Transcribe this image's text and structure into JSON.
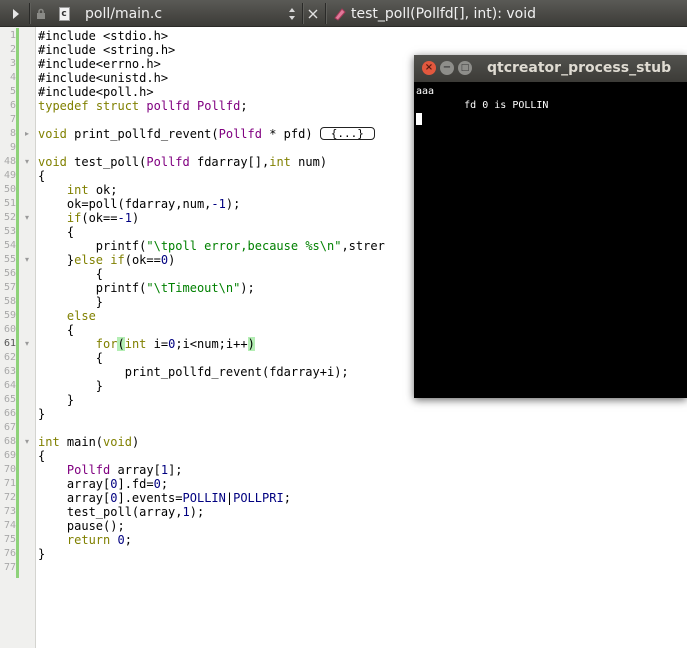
{
  "toolbar": {
    "file_name": "poll/main.c",
    "file_type_letter": "c",
    "function_signature": "test_poll(Pollfd[], int): void",
    "icons": [
      "forward-icon",
      "lock-icon",
      "file-c-icon",
      "updown-arrow-icon",
      "close-icon",
      "function-tag-icon"
    ]
  },
  "editor": {
    "current_line": "61",
    "line_numbers": [
      "1",
      "2",
      "3",
      "4",
      "5",
      "6",
      "7",
      "8",
      "9",
      "48",
      "49",
      "50",
      "51",
      "52",
      "53",
      "54",
      "55",
      "56",
      "57",
      "58",
      "59",
      "60",
      "61",
      "62",
      "63",
      "64",
      "65",
      "66",
      "67",
      "68",
      "69",
      "70",
      "71",
      "72",
      "73",
      "74",
      "75",
      "76",
      "77"
    ],
    "lines": [
      "#include <stdio.h>",
      "#include <string.h>",
      "#include<errno.h>",
      "#include<unistd.h>",
      "#include<poll.h>",
      "typedef struct pollfd Pollfd;",
      "",
      "void print_pollfd_revent(Pollfd * pfd) {...}",
      "",
      "void test_poll(Pollfd fdarray[],int num)",
      "{",
      "    int ok;",
      "    ok=poll(fdarray,num,-1);",
      "    if(ok==-1)",
      "    {",
      "        printf(\"\\tpoll error,because %s\\n\",strer",
      "    }else if(ok==0)",
      "        {",
      "        printf(\"\\tTimeout\\n\");",
      "        }",
      "    else",
      "    {",
      "        for(int i=0;i<num;i++)",
      "        {",
      "            print_pollfd_revent(fdarray+i);",
      "        }",
      "    }",
      "}",
      "",
      "int main(void)",
      "{",
      "    Pollfd array[1];",
      "    array[0].fd=0;",
      "    array[0].events=POLLIN|POLLPRI;",
      "    test_poll(array,1);",
      "    pause();",
      "    return 0;",
      "}",
      ""
    ],
    "folded_marker": "{...}"
  },
  "terminal": {
    "title": "qtcreator_process_stub",
    "output_line1": "aaa",
    "output_line2": "        fd 0 is POLLIN",
    "buttons": {
      "close": "×",
      "minimize": "−",
      "maximize": "□"
    }
  },
  "colors": {
    "keyword": "#808000",
    "string": "#008000",
    "number": "#000080",
    "type": "#800080",
    "gutter_changed": "#8ed27a",
    "terminal_bg": "#000000",
    "close_button": "#e2583e"
  }
}
